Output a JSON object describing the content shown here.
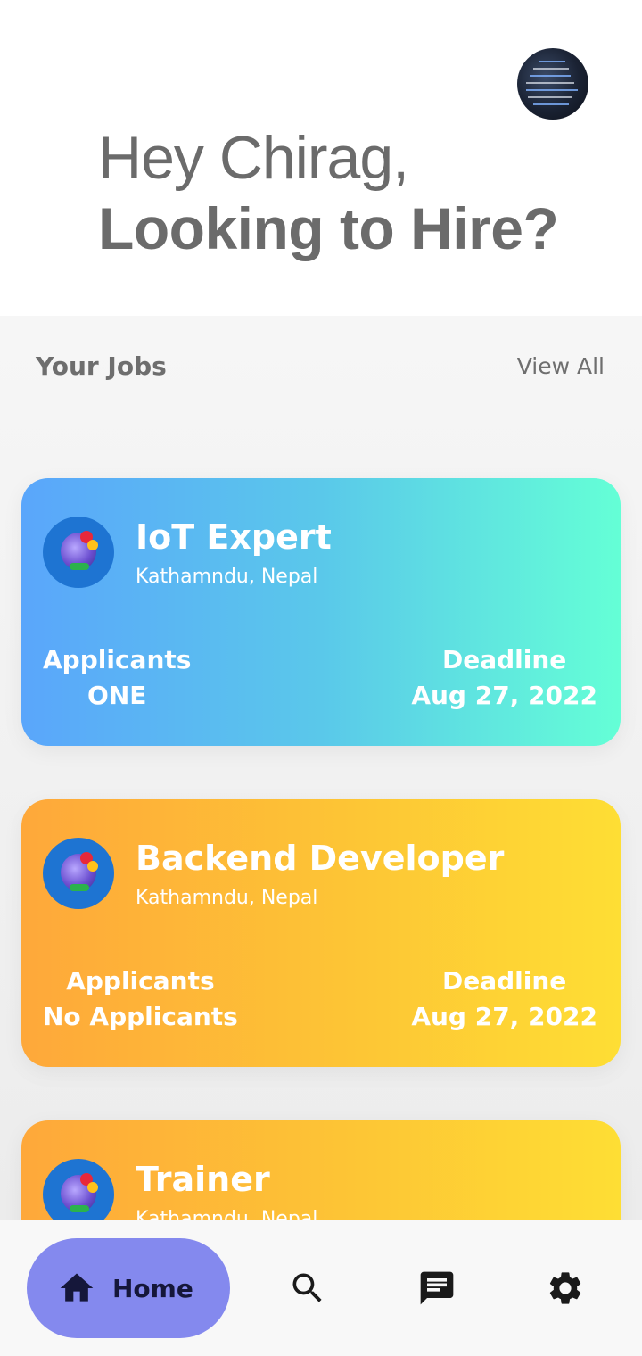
{
  "header": {
    "greeting": "Hey Chirag,",
    "headline": "Looking to Hire?",
    "avatar_icon": "user-avatar"
  },
  "jobs_section": {
    "title": "Your Jobs",
    "view_all_label": "View All"
  },
  "jobs": [
    {
      "title": "IoT Expert",
      "location": "Kathamndu, Nepal",
      "applicants_label": "Applicants",
      "applicants_value": "ONE",
      "deadline_label": "Deadline",
      "deadline_value": "Aug 27, 2022",
      "theme": "blue"
    },
    {
      "title": "Backend Developer",
      "location": "Kathamndu, Nepal",
      "applicants_label": "Applicants",
      "applicants_value": "No Applicants",
      "deadline_label": "Deadline",
      "deadline_value": "Aug 27, 2022",
      "theme": "orange"
    },
    {
      "title": "Trainer",
      "location": "Kathamndu, Nepal",
      "theme": "orange"
    }
  ],
  "bottom_nav": {
    "home_label": "Home",
    "items": [
      "home-icon",
      "search-icon",
      "chat-icon",
      "settings-icon"
    ]
  },
  "colors": {
    "nav_active": "#8489ee",
    "card_blue_start": "#5aa6fb",
    "card_blue_end": "#64ffd6",
    "card_orange_start": "#fea83a",
    "card_orange_end": "#fede34"
  }
}
